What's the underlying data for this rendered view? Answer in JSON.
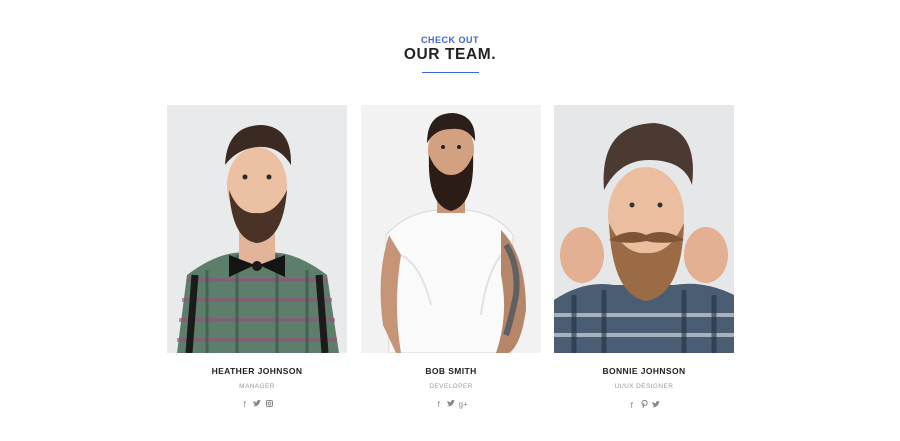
{
  "header": {
    "kicker": "CHECK OUT",
    "title": "OUR TEAM."
  },
  "colors": {
    "accent": "#3e66d6"
  },
  "team": [
    {
      "name": "HEATHER JOHNSON",
      "role": "MANAGER",
      "socials": [
        {
          "icon": "facebook-icon",
          "glyph": "f"
        },
        {
          "icon": "twitter-icon",
          "glyph": "🐦"
        },
        {
          "icon": "instagram-icon",
          "glyph": "◘"
        }
      ]
    },
    {
      "name": "BOB SMITH",
      "role": "DEVELOPER",
      "socials": [
        {
          "icon": "facebook-icon",
          "glyph": "f"
        },
        {
          "icon": "twitter-icon",
          "glyph": "🐦"
        },
        {
          "icon": "google-plus-icon",
          "glyph": "g+"
        }
      ]
    },
    {
      "name": "BONNIE JOHNSON",
      "role": "UI/UX DESIGNER",
      "socials": [
        {
          "icon": "facebook-icon",
          "glyph": "f"
        },
        {
          "icon": "pinterest-icon",
          "glyph": "℗"
        },
        {
          "icon": "twitter-icon",
          "glyph": "🐦"
        }
      ]
    }
  ]
}
